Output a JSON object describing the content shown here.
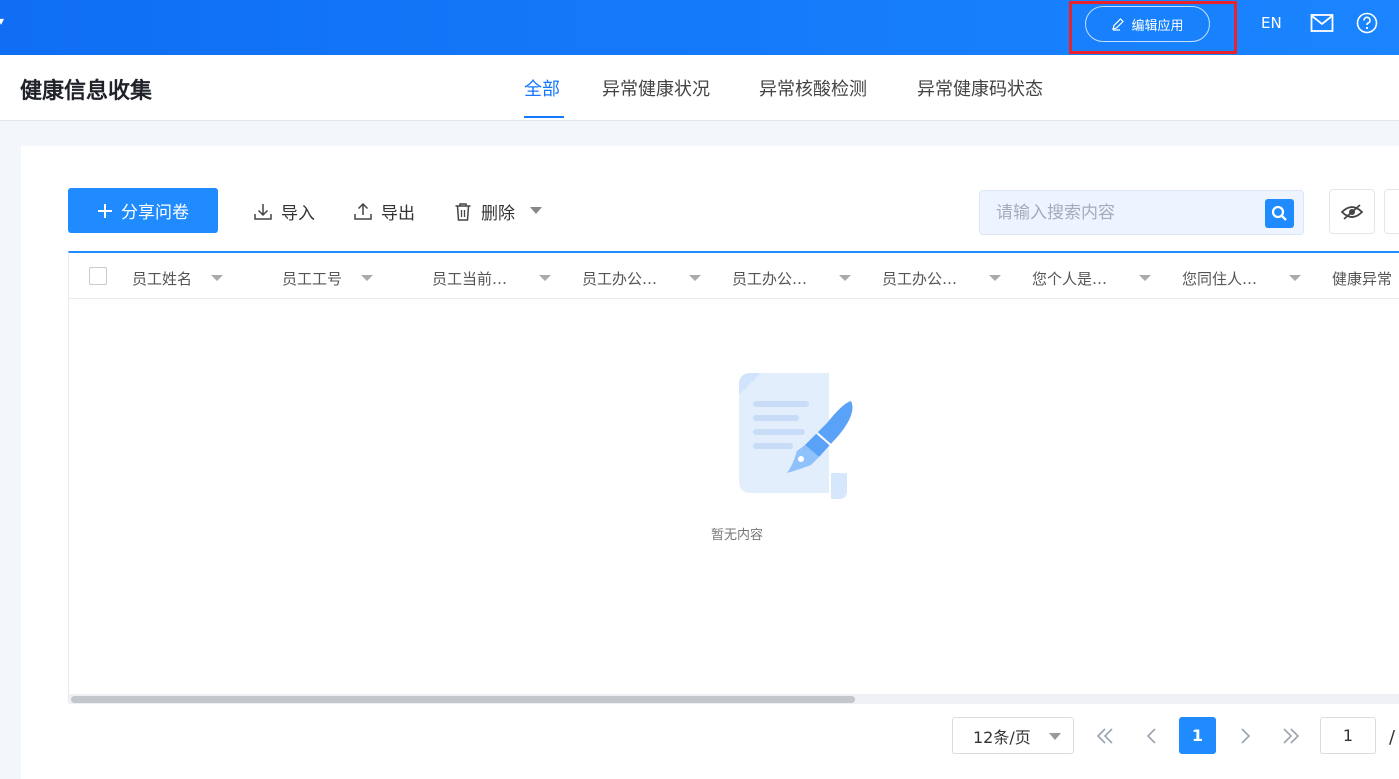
{
  "topbar": {
    "edit_app_label": "编辑应用",
    "lang_label": "EN"
  },
  "header": {
    "title": "健康信息收集",
    "tabs": [
      {
        "label": "全部",
        "active": true
      },
      {
        "label": "异常健康状况",
        "active": false
      },
      {
        "label": "异常核酸检测",
        "active": false
      },
      {
        "label": "异常健康码状态",
        "active": false
      }
    ]
  },
  "toolbar": {
    "share_label": "分享问卷",
    "import_label": "导入",
    "export_label": "导出",
    "delete_label": "删除",
    "search_placeholder": "请输入搜索内容"
  },
  "table": {
    "columns": [
      "员工姓名",
      "员工工号",
      "员工当前…",
      "员工办公…",
      "员工办公…",
      "员工办公…",
      "您个人是…",
      "您同住人…",
      "健康异常"
    ],
    "empty_text": "暂无内容"
  },
  "pagination": {
    "page_size_label": "12条/页",
    "current_page": "1",
    "jump_value": "1",
    "slash": "/"
  },
  "colors": {
    "primary": "#1f8bff",
    "highlight": "#e8232c"
  }
}
